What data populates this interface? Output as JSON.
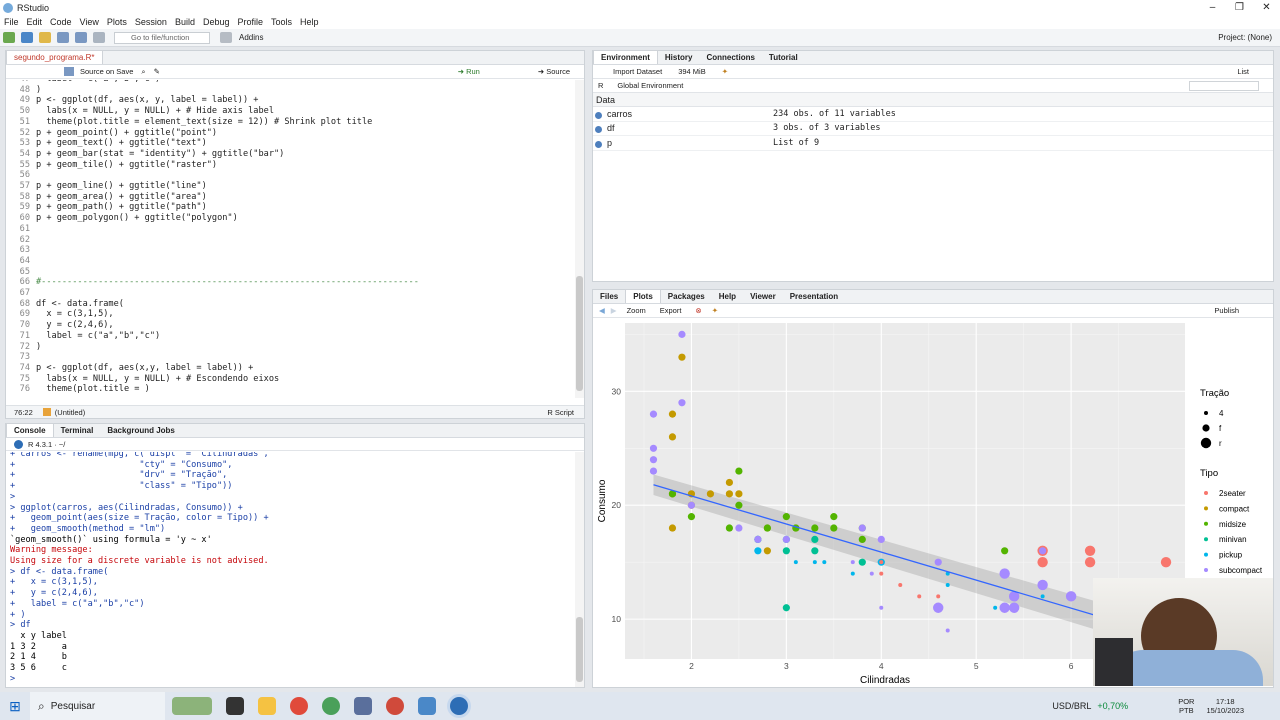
{
  "window": {
    "title": "RStudio",
    "min": "–",
    "max": "❐",
    "close": "✕"
  },
  "menu": [
    "File",
    "Edit",
    "Code",
    "View",
    "Plots",
    "Session",
    "Build",
    "Debug",
    "Profile",
    "Tools",
    "Help"
  ],
  "toolbar": {
    "goto_placeholder": "Go to file/function",
    "addins": "Addins",
    "project": "Project: (None)"
  },
  "editor": {
    "tab": "segundo_programa.R*",
    "source_on_save": "Source on Save",
    "run": "Run",
    "source": "Source",
    "lines": [
      {
        "n": "47",
        "t": "  label = c(\"a\",\"b\",\"c\")"
      },
      {
        "n": "48",
        "t": ")"
      },
      {
        "n": "49",
        "t": "p <- ggplot(df, aes(x, y, label = label)) +"
      },
      {
        "n": "50",
        "t": "  labs(x = NULL, y = NULL) + # Hide axis label"
      },
      {
        "n": "51",
        "t": "  theme(plot.title = element_text(size = 12)) # Shrink plot title"
      },
      {
        "n": "52",
        "t": "p + geom_point() + ggtitle(\"point\")"
      },
      {
        "n": "53",
        "t": "p + geom_text() + ggtitle(\"text\")"
      },
      {
        "n": "54",
        "t": "p + geom_bar(stat = \"identity\") + ggtitle(\"bar\")"
      },
      {
        "n": "55",
        "t": "p + geom_tile() + ggtitle(\"raster\")"
      },
      {
        "n": "56",
        "t": ""
      },
      {
        "n": "57",
        "t": "p + geom_line() + ggtitle(\"line\")"
      },
      {
        "n": "58",
        "t": "p + geom_area() + ggtitle(\"area\")"
      },
      {
        "n": "59",
        "t": "p + geom_path() + ggtitle(\"path\")"
      },
      {
        "n": "60",
        "t": "p + geom_polygon() + ggtitle(\"polygon\")"
      },
      {
        "n": "61",
        "t": ""
      },
      {
        "n": "62",
        "t": ""
      },
      {
        "n": "63",
        "t": ""
      },
      {
        "n": "64",
        "t": ""
      },
      {
        "n": "65",
        "t": ""
      },
      {
        "n": "66",
        "t": "#-------------------------------------------------------------------------"
      },
      {
        "n": "67",
        "t": ""
      },
      {
        "n": "68",
        "t": "df <- data.frame("
      },
      {
        "n": "69",
        "t": "  x = c(3,1,5),"
      },
      {
        "n": "70",
        "t": "  y = c(2,4,6),"
      },
      {
        "n": "71",
        "t": "  label = c(\"a\",\"b\",\"c\")"
      },
      {
        "n": "72",
        "t": ")"
      },
      {
        "n": "73",
        "t": ""
      },
      {
        "n": "74",
        "t": "p <- ggplot(df, aes(x,y, label = label)) +"
      },
      {
        "n": "75",
        "t": "  labs(x = NULL, y = NULL) + # Escondendo eixos"
      },
      {
        "n": "76",
        "t": "  theme(plot.title = )"
      }
    ],
    "status_pos": "76:22",
    "status_scope": "(Untitled)",
    "status_type": "R Script"
  },
  "console": {
    "tabs": [
      "Console",
      "Terminal",
      "Background Jobs"
    ],
    "version": "R 4.3.1 · ~/",
    "lines": [
      {
        "c": "in",
        "t": "+ carros <- rename(mpg, c(\"displ\" = \"Cilindradas\","
      },
      {
        "c": "in",
        "t": "+                        \"cty\" = \"Consumo\","
      },
      {
        "c": "in",
        "t": "+                        \"drv\" = \"Tração\","
      },
      {
        "c": "in",
        "t": "+                        \"class\" = \"Tipo\"))"
      },
      {
        "c": "in",
        "t": ">"
      },
      {
        "c": "in",
        "t": "> ggplot(carros, aes(Cilindradas, Consumo)) +"
      },
      {
        "c": "in",
        "t": "+   geom_point(aes(size = Tração, color = Tipo)) +"
      },
      {
        "c": "in",
        "t": "+   geom_smooth(method = \"lm\")"
      },
      {
        "c": "out",
        "t": "`geom_smooth()` using formula = 'y ~ x'"
      },
      {
        "c": "err",
        "t": "Warning message:"
      },
      {
        "c": "err",
        "t": "Using size for a discrete variable is not advised."
      },
      {
        "c": "in",
        "t": "> df <- data.frame("
      },
      {
        "c": "in",
        "t": "+   x = c(3,1,5),"
      },
      {
        "c": "in",
        "t": "+   y = c(2,4,6),"
      },
      {
        "c": "in",
        "t": "+   label = c(\"a\",\"b\",\"c\")"
      },
      {
        "c": "in",
        "t": "+ )"
      },
      {
        "c": "in",
        "t": "> df"
      },
      {
        "c": "out",
        "t": "  x y label"
      },
      {
        "c": "out",
        "t": "1 3 2     a"
      },
      {
        "c": "out",
        "t": "2 1 4     b"
      },
      {
        "c": "out",
        "t": "3 5 6     c"
      },
      {
        "c": "in",
        "t": "> "
      }
    ]
  },
  "environment": {
    "tabs": [
      "Environment",
      "History",
      "Connections",
      "Tutorial"
    ],
    "import": "Import Dataset",
    "memory": "394 MiB",
    "list": "List",
    "lang": "R",
    "scope": "Global Environment",
    "section": "Data",
    "rows": [
      {
        "name": "carros",
        "value": "234 obs. of 11 variables"
      },
      {
        "name": "df",
        "value": "3 obs. of 3 variables"
      },
      {
        "name": "p",
        "value": "List of  9"
      }
    ]
  },
  "plots_pane": {
    "tabs": [
      "Files",
      "Plots",
      "Packages",
      "Help",
      "Viewer",
      "Presentation"
    ],
    "zoom": "Zoom",
    "export": "Export",
    "publish": "Publish"
  },
  "chart_data": {
    "type": "scatter",
    "xlabel": "Cilindradas",
    "ylabel": "Consumo",
    "xlim": [
      1.3,
      7.2
    ],
    "ylim": [
      6.5,
      36
    ],
    "xticks": [
      2,
      3,
      4,
      5,
      6
    ],
    "yticks": [
      10,
      20,
      30
    ],
    "grid": true,
    "legend_size": {
      "title": "Tração",
      "entries": [
        "4",
        "f",
        "r"
      ]
    },
    "legend_color": {
      "title": "Tipo",
      "entries": [
        "2seater",
        "compact",
        "midsize",
        "minivan",
        "pickup",
        "subcompact"
      ],
      "colors": [
        "#F8766D",
        "#C49A00",
        "#53B400",
        "#00C094",
        "#00B6EB",
        "#A58AFF"
      ]
    },
    "smooth": {
      "method": "lm",
      "x": [
        1.6,
        7.0
      ],
      "y": [
        21.8,
        8.5
      ],
      "color": "#3366FF"
    },
    "points": [
      {
        "x": 1.8,
        "y": 18,
        "s": 1,
        "c": 1
      },
      {
        "x": 1.8,
        "y": 21,
        "s": 1,
        "c": 1
      },
      {
        "x": 2.0,
        "y": 20,
        "s": 1,
        "c": 1
      },
      {
        "x": 2.0,
        "y": 21,
        "s": 1,
        "c": 1
      },
      {
        "x": 2.8,
        "y": 16,
        "s": 1,
        "c": 1
      },
      {
        "x": 2.8,
        "y": 18,
        "s": 1,
        "c": 1
      },
      {
        "x": 3.1,
        "y": 18,
        "s": 1,
        "c": 1
      },
      {
        "x": 1.8,
        "y": 28,
        "s": 1,
        "c": 1
      },
      {
        "x": 1.8,
        "y": 26,
        "s": 1,
        "c": 1
      },
      {
        "x": 1.9,
        "y": 33,
        "s": 1,
        "c": 1
      },
      {
        "x": 1.9,
        "y": 35,
        "s": 1,
        "c": 5
      },
      {
        "x": 2.4,
        "y": 21,
        "s": 1,
        "c": 1
      },
      {
        "x": 2.4,
        "y": 22,
        "s": 1,
        "c": 1
      },
      {
        "x": 2.5,
        "y": 21,
        "s": 1,
        "c": 1
      },
      {
        "x": 2.2,
        "y": 21,
        "s": 1,
        "c": 1
      },
      {
        "x": 1.6,
        "y": 28,
        "s": 1,
        "c": 5
      },
      {
        "x": 1.6,
        "y": 25,
        "s": 1,
        "c": 5
      },
      {
        "x": 1.6,
        "y": 24,
        "s": 1,
        "c": 5
      },
      {
        "x": 1.6,
        "y": 23,
        "s": 1,
        "c": 5
      },
      {
        "x": 1.9,
        "y": 29,
        "s": 1,
        "c": 5
      },
      {
        "x": 2.0,
        "y": 20,
        "s": 1,
        "c": 5
      },
      {
        "x": 2.5,
        "y": 18,
        "s": 1,
        "c": 5
      },
      {
        "x": 1.8,
        "y": 21,
        "s": 1,
        "c": 2
      },
      {
        "x": 2.0,
        "y": 19,
        "s": 1,
        "c": 2
      },
      {
        "x": 2.4,
        "y": 18,
        "s": 1,
        "c": 2
      },
      {
        "x": 2.5,
        "y": 23,
        "s": 1,
        "c": 2
      },
      {
        "x": 2.5,
        "y": 20,
        "s": 1,
        "c": 2
      },
      {
        "x": 3.0,
        "y": 19,
        "s": 1,
        "c": 2
      },
      {
        "x": 3.3,
        "y": 18,
        "s": 1,
        "c": 2
      },
      {
        "x": 3.5,
        "y": 19,
        "s": 1,
        "c": 2
      },
      {
        "x": 3.5,
        "y": 18,
        "s": 1,
        "c": 2
      },
      {
        "x": 3.8,
        "y": 17,
        "s": 1,
        "c": 2
      },
      {
        "x": 3.8,
        "y": 18,
        "s": 1,
        "c": 2
      },
      {
        "x": 2.8,
        "y": 18,
        "s": 1,
        "c": 2
      },
      {
        "x": 3.1,
        "y": 18,
        "s": 1,
        "c": 2
      },
      {
        "x": 2.7,
        "y": 17,
        "s": 1,
        "c": 2
      },
      {
        "x": 3.3,
        "y": 17,
        "s": 1,
        "c": 3
      },
      {
        "x": 3.0,
        "y": 17,
        "s": 1,
        "c": 3
      },
      {
        "x": 3.8,
        "y": 15,
        "s": 1,
        "c": 3
      },
      {
        "x": 3.3,
        "y": 16,
        "s": 1,
        "c": 3
      },
      {
        "x": 3.0,
        "y": 16,
        "s": 1,
        "c": 3
      },
      {
        "x": 3.0,
        "y": 11,
        "s": 1,
        "c": 3
      },
      {
        "x": 2.7,
        "y": 16,
        "s": 1,
        "c": 4
      },
      {
        "x": 2.7,
        "y": 17,
        "s": 1,
        "c": 4
      },
      {
        "x": 3.4,
        "y": 15,
        "s": 0,
        "c": 4
      },
      {
        "x": 4.0,
        "y": 15,
        "s": 1,
        "c": 4
      },
      {
        "x": 4.7,
        "y": 14,
        "s": 0,
        "c": 4
      },
      {
        "x": 4.7,
        "y": 13,
        "s": 0,
        "c": 4
      },
      {
        "x": 5.2,
        "y": 11,
        "s": 0,
        "c": 4
      },
      {
        "x": 5.7,
        "y": 12,
        "s": 0,
        "c": 4
      },
      {
        "x": 4.6,
        "y": 15,
        "s": 1,
        "c": 5
      },
      {
        "x": 4.0,
        "y": 17,
        "s": 1,
        "c": 5
      },
      {
        "x": 3.8,
        "y": 18,
        "s": 1,
        "c": 5
      },
      {
        "x": 2.7,
        "y": 17,
        "s": 1,
        "c": 5
      },
      {
        "x": 3.0,
        "y": 17,
        "s": 1,
        "c": 5
      },
      {
        "x": 5.7,
        "y": 16,
        "s": 2,
        "c": 0
      },
      {
        "x": 5.7,
        "y": 15,
        "s": 2,
        "c": 0
      },
      {
        "x": 6.2,
        "y": 16,
        "s": 2,
        "c": 0
      },
      {
        "x": 6.2,
        "y": 15,
        "s": 2,
        "c": 0
      },
      {
        "x": 7.0,
        "y": 15,
        "s": 2,
        "c": 0
      },
      {
        "x": 5.3,
        "y": 14,
        "s": 2,
        "c": 5
      },
      {
        "x": 5.4,
        "y": 12,
        "s": 2,
        "c": 5
      },
      {
        "x": 5.7,
        "y": 13,
        "s": 2,
        "c": 5
      },
      {
        "x": 6.0,
        "y": 12,
        "s": 2,
        "c": 5
      },
      {
        "x": 4.6,
        "y": 11,
        "s": 2,
        "c": 5
      },
      {
        "x": 5.3,
        "y": 11,
        "s": 2,
        "c": 5
      },
      {
        "x": 5.4,
        "y": 11,
        "s": 2,
        "c": 5
      },
      {
        "x": 4.0,
        "y": 15,
        "s": 0,
        "c": 0
      },
      {
        "x": 4.0,
        "y": 14,
        "s": 0,
        "c": 0
      },
      {
        "x": 4.2,
        "y": 13,
        "s": 0,
        "c": 0
      },
      {
        "x": 4.6,
        "y": 12,
        "s": 0,
        "c": 0
      },
      {
        "x": 4.6,
        "y": 11,
        "s": 0,
        "c": 5
      },
      {
        "x": 4.7,
        "y": 9,
        "s": 0,
        "c": 5
      },
      {
        "x": 5.3,
        "y": 14,
        "s": 0,
        "c": 5
      },
      {
        "x": 4.0,
        "y": 11,
        "s": 0,
        "c": 5
      },
      {
        "x": 3.7,
        "y": 15,
        "s": 0,
        "c": 5
      },
      {
        "x": 3.9,
        "y": 14,
        "s": 0,
        "c": 5
      },
      {
        "x": 4.4,
        "y": 12,
        "s": 0,
        "c": 0
      },
      {
        "x": 3.1,
        "y": 15,
        "s": 0,
        "c": 4
      },
      {
        "x": 3.7,
        "y": 14,
        "s": 0,
        "c": 4
      },
      {
        "x": 3.3,
        "y": 15,
        "s": 0,
        "c": 4
      },
      {
        "x": 5.3,
        "y": 16,
        "s": 1,
        "c": 2
      },
      {
        "x": 5.7,
        "y": 16,
        "s": 1,
        "c": 5
      }
    ]
  },
  "taskbar": {
    "search": "Pesquisar",
    "currency": "USD/BRL",
    "change": "+0,70%",
    "lang1": "POR",
    "lang2": "PTB",
    "time": "17:18",
    "date": "15/10/2023"
  }
}
